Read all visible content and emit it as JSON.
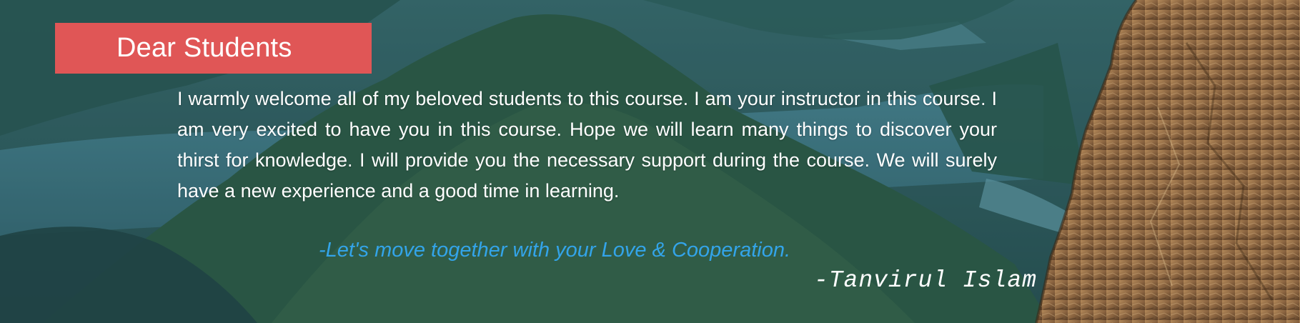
{
  "banner": {
    "title": "Dear Students",
    "color": "#e05656"
  },
  "message": {
    "body": "I warmly welcome all of my beloved students to this course. I am your instructor in this course. I am very excited to have you in this course. Hope we will learn many things to discover your thirst for knowledge.  I will provide you the necessary support during the course. We will surely have a new experience and a good time in learning.",
    "motto": "-Let's move together with your Love & Cooperation.",
    "signature": "-Tanvirul Islam"
  },
  "colors": {
    "motto_text": "#33a4e9",
    "body_text": "#ffffff"
  },
  "background": {
    "scene": "mountain-lake-landscape",
    "overlay_color": "#2e5a5c"
  }
}
